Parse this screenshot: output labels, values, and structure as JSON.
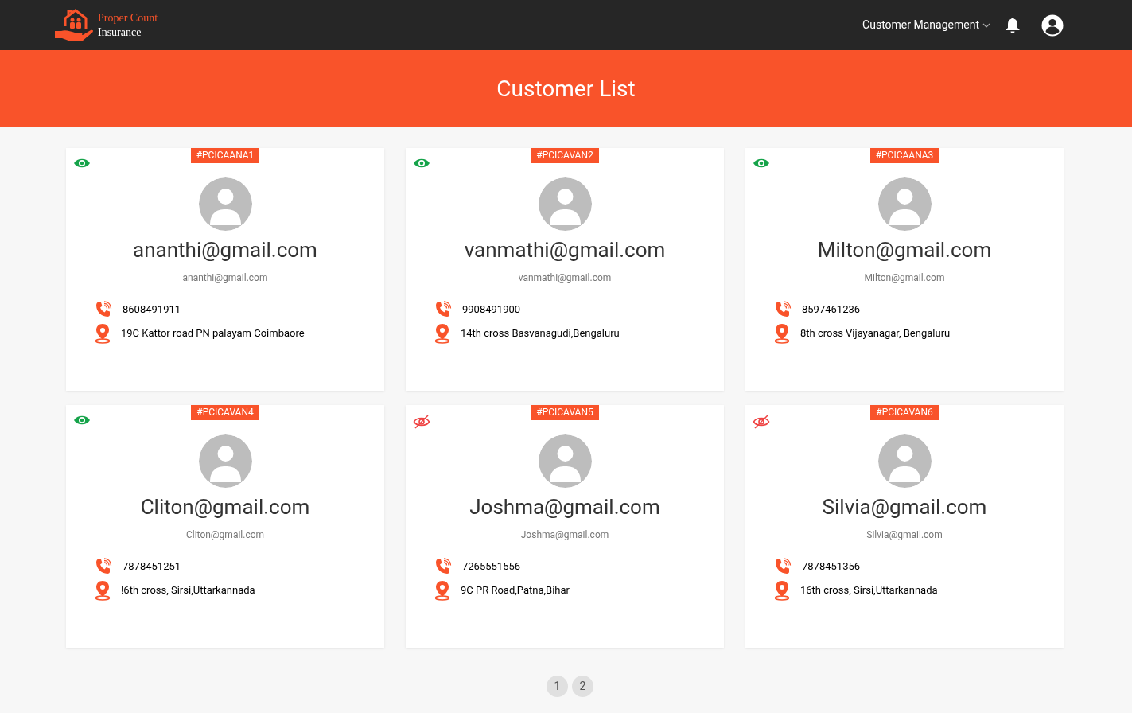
{
  "brand": {
    "line1": "Proper Count",
    "line2": "Insurance"
  },
  "nav": {
    "menu": "Customer Management"
  },
  "banner": {
    "title": "Customer List"
  },
  "customers": [
    {
      "code": "#PCICAANA1",
      "visible": true,
      "name": "ananthi@gmail.com",
      "email": "ananthi@gmail.com",
      "phone": "8608491911",
      "address": "19C Kattor road PN palayam Coimbaore"
    },
    {
      "code": "#PCICAVAN2",
      "visible": true,
      "name": "vanmathi@gmail.com",
      "email": "vanmathi@gmail.com",
      "phone": "9908491900",
      "address": "14th cross Basvanagudi,Bengaluru"
    },
    {
      "code": "#PCICAANA3",
      "visible": true,
      "name": "Milton@gmail.com",
      "email": "Milton@gmail.com",
      "phone": "8597461236",
      "address": "8th cross Vijayanagar, Bengaluru"
    },
    {
      "code": "#PCICAVAN4",
      "visible": true,
      "name": "Cliton@gmail.com",
      "email": "Cliton@gmail.com",
      "phone": "7878451251",
      "address": "!6th cross, Sirsi,Uttarkannada"
    },
    {
      "code": "#PCICAVAN5",
      "visible": false,
      "name": "Joshma@gmail.com",
      "email": "Joshma@gmail.com",
      "phone": "7265551556",
      "address": "9C PR Road,Patna,Bihar"
    },
    {
      "code": "#PCICAVAN6",
      "visible": false,
      "name": "Silvia@gmail.com",
      "email": "Silvia@gmail.com",
      "phone": "7878451356",
      "address": "16th cross, Sirsi,Uttarkannada"
    }
  ],
  "pagination": [
    "1",
    "2"
  ]
}
